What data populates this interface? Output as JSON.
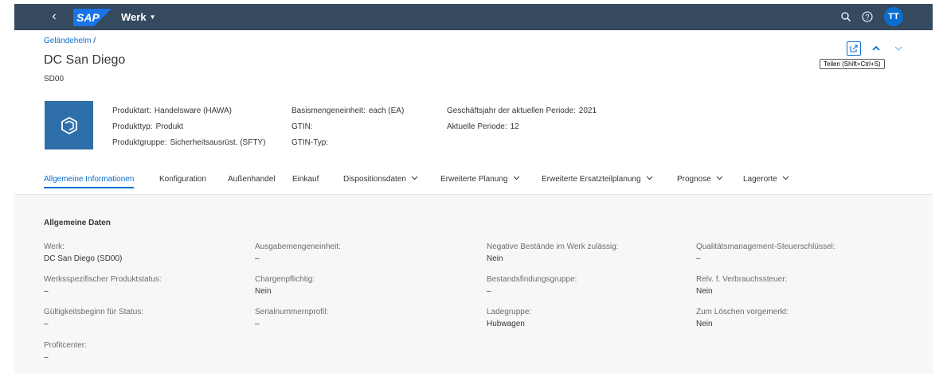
{
  "shell": {
    "app_title": "Werk",
    "avatar_initials": "TT",
    "icons": {
      "back": "back-chevron-icon",
      "search": "search-icon",
      "help": "help-icon",
      "title_menu": "caret-down-icon"
    },
    "colors": {
      "shell_bg": "#354a5f",
      "avatar_bg": "#0a6ed1",
      "sap_logo": "#1a73e8"
    }
  },
  "header": {
    "breadcrumb": "Geländehelm",
    "breadcrumb_separator": "/",
    "title": "DC San Diego",
    "subtitle": "SD00",
    "tooltip": "Teilen (Shift+Ctrl+S)",
    "actions": [
      "share-icon",
      "navigate-up-icon",
      "navigate-down-icon"
    ],
    "attributes": {
      "produktart_label": "Produktart:",
      "produktart_value": "Handelsware (HAWA)",
      "produkttyp_label": "Produkttyp:",
      "produkttyp_value": "Produkt",
      "produktgruppe_label": "Produktgruppe:",
      "produktgruppe_value": "Sicherheitsausrüst. (SFTY)",
      "basismenge_label": "Basismengeneinheit:",
      "basismenge_value": "each (EA)",
      "gtin_label": "GTIN:",
      "gtintyp_label": "GTIN-Typ:",
      "geschaeftsjahr_label": "Geschäftsjahr der aktuellen Periode:",
      "geschaeftsjahr_value": "2021",
      "periode_label": "Aktuelle Periode:",
      "periode_value": "12"
    },
    "object_icon": "product-box-icon"
  },
  "tabs": [
    {
      "label": "Allgemeine Informationen",
      "active": true
    },
    {
      "label": "Konfiguration"
    },
    {
      "label": "Außenhandel"
    },
    {
      "label": "Einkauf"
    },
    {
      "label": "Dispositionsdaten",
      "dropdown": true
    },
    {
      "label": "Erweiterte Planung",
      "dropdown": true
    },
    {
      "label": "Erweiterte Ersatzteilplanung",
      "dropdown": true
    },
    {
      "label": "Prognose",
      "dropdown": true
    },
    {
      "label": "Lagerorte",
      "dropdown": true
    }
  ],
  "section": {
    "title": "Allgemeine Daten",
    "fields": [
      {
        "label": "Werk:",
        "value": "DC San Diego (SD00)"
      },
      {
        "label": "Ausgabemengeneinheit:",
        "value": "–"
      },
      {
        "label": "Negative Bestände im Werk zulässig:",
        "value": "Nein"
      },
      {
        "label": "Qualitätsmanagement-Steuerschlüssel:",
        "value": "–"
      },
      {
        "label": "Werksspezifischer Produktstatus:",
        "value": "–"
      },
      {
        "label": "Chargenpflichtig:",
        "value": "Nein"
      },
      {
        "label": "Bestandsfindungsgruppe:",
        "value": "–"
      },
      {
        "label": "Relv. f. Verbrauchssteuer:",
        "value": "Nein"
      },
      {
        "label": "Gültigkeitsbeginn für Status:",
        "value": "–"
      },
      {
        "label": "Serialnummernprofil:",
        "value": "–"
      },
      {
        "label": "Ladegruppe:",
        "value": "Hubwagen"
      },
      {
        "label": "Zum Löschen vorgemerkt:",
        "value": "Nein"
      },
      {
        "label": "Profitcenter:",
        "value": "–"
      }
    ]
  }
}
